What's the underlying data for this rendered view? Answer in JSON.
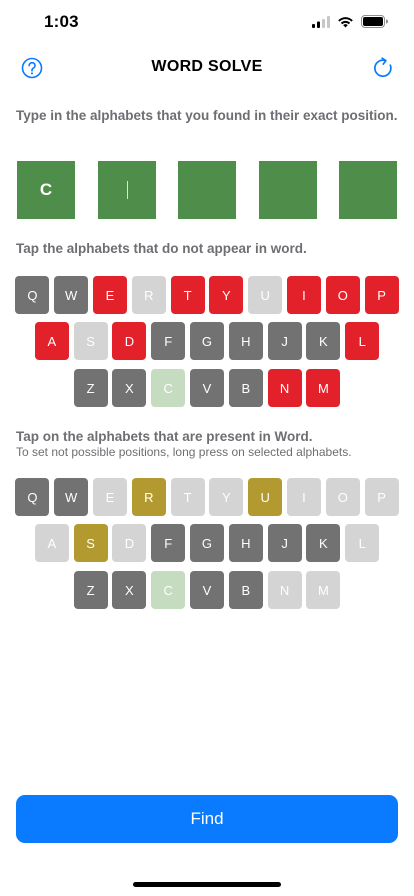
{
  "status_bar": {
    "time": "1:03",
    "icons": [
      "signal-icon",
      "wifi-icon",
      "battery-icon"
    ]
  },
  "header": {
    "title": "WORD SOLVE",
    "left_icon": "help-icon",
    "right_icon": "refresh-icon",
    "accent_color": "#0a7aff"
  },
  "position_section": {
    "instruction": "Type in the alphabets that you found in their exact position.",
    "slots": [
      {
        "value": "C",
        "focused": false
      },
      {
        "value": "",
        "focused": true
      },
      {
        "value": "",
        "focused": false
      },
      {
        "value": "",
        "focused": false
      },
      {
        "value": "",
        "focused": false
      }
    ],
    "slot_color": "#4f8d4b"
  },
  "absent_section": {
    "instruction": "Tap the alphabets that do not appear in word.",
    "rows": [
      [
        {
          "k": "Q",
          "s": "dark"
        },
        {
          "k": "W",
          "s": "dark"
        },
        {
          "k": "E",
          "s": "red"
        },
        {
          "k": "R",
          "s": "light"
        },
        {
          "k": "T",
          "s": "red"
        },
        {
          "k": "Y",
          "s": "red"
        },
        {
          "k": "U",
          "s": "light"
        },
        {
          "k": "I",
          "s": "red"
        },
        {
          "k": "O",
          "s": "red"
        },
        {
          "k": "P",
          "s": "red"
        }
      ],
      [
        {
          "k": "A",
          "s": "red"
        },
        {
          "k": "S",
          "s": "light"
        },
        {
          "k": "D",
          "s": "red"
        },
        {
          "k": "F",
          "s": "dark"
        },
        {
          "k": "G",
          "s": "dark"
        },
        {
          "k": "H",
          "s": "dark"
        },
        {
          "k": "J",
          "s": "dark"
        },
        {
          "k": "K",
          "s": "dark"
        },
        {
          "k": "L",
          "s": "red"
        }
      ],
      [
        {
          "k": "Z",
          "s": "dark"
        },
        {
          "k": "X",
          "s": "dark"
        },
        {
          "k": "C",
          "s": "green"
        },
        {
          "k": "V",
          "s": "dark"
        },
        {
          "k": "B",
          "s": "dark"
        },
        {
          "k": "N",
          "s": "red"
        },
        {
          "k": "M",
          "s": "red"
        }
      ]
    ]
  },
  "present_section": {
    "instruction": "Tap on the alphabets that are present in Word.",
    "sub_instruction": "To set not possible positions, long press on selected alphabets.",
    "rows": [
      [
        {
          "k": "Q",
          "s": "dark"
        },
        {
          "k": "W",
          "s": "dark"
        },
        {
          "k": "E",
          "s": "light"
        },
        {
          "k": "R",
          "s": "gold"
        },
        {
          "k": "T",
          "s": "light"
        },
        {
          "k": "Y",
          "s": "light"
        },
        {
          "k": "U",
          "s": "gold"
        },
        {
          "k": "I",
          "s": "light"
        },
        {
          "k": "O",
          "s": "light"
        },
        {
          "k": "P",
          "s": "light"
        }
      ],
      [
        {
          "k": "A",
          "s": "light"
        },
        {
          "k": "S",
          "s": "gold"
        },
        {
          "k": "D",
          "s": "light"
        },
        {
          "k": "F",
          "s": "dark"
        },
        {
          "k": "G",
          "s": "dark"
        },
        {
          "k": "H",
          "s": "dark"
        },
        {
          "k": "J",
          "s": "dark"
        },
        {
          "k": "K",
          "s": "dark"
        },
        {
          "k": "L",
          "s": "light"
        }
      ],
      [
        {
          "k": "Z",
          "s": "dark"
        },
        {
          "k": "X",
          "s": "dark"
        },
        {
          "k": "C",
          "s": "green"
        },
        {
          "k": "V",
          "s": "dark"
        },
        {
          "k": "B",
          "s": "dark"
        },
        {
          "k": "N",
          "s": "light"
        },
        {
          "k": "M",
          "s": "light"
        }
      ]
    ]
  },
  "state_colors": {
    "dark": "#727272",
    "light": "#d4d4d4",
    "red": "#e3212b",
    "green": "#c5dcc1",
    "gold": "#b39a30"
  },
  "footer": {
    "find_label": "Find"
  }
}
